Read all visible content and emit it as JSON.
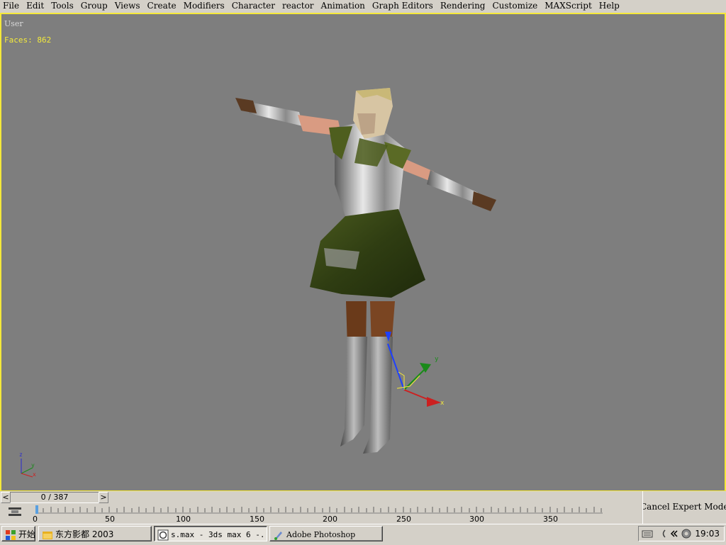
{
  "menubar": {
    "items": [
      {
        "label": "File"
      },
      {
        "label": "Edit"
      },
      {
        "label": "Tools"
      },
      {
        "label": "Group"
      },
      {
        "label": "Views"
      },
      {
        "label": "Create"
      },
      {
        "label": "Modifiers"
      },
      {
        "label": "Character"
      },
      {
        "label": "reactor"
      },
      {
        "label": "Animation"
      },
      {
        "label": "Graph Editors"
      },
      {
        "label": "Rendering"
      },
      {
        "label": "Customize"
      },
      {
        "label": "MAXScript"
      },
      {
        "label": "Help"
      }
    ]
  },
  "viewport": {
    "label": "User",
    "faces": "Faces: 862",
    "gizmo_axes": {
      "x": "x",
      "y": "y",
      "z": "z"
    },
    "corner_axes": {
      "x": "x",
      "y": "y",
      "z": "z"
    },
    "border_color": "#f5e83a",
    "background_color": "#7e7e7e"
  },
  "time_slider": {
    "value": "0 / 387",
    "prev_button": "<",
    "next_button": ">",
    "current_frame": 0,
    "total_frames": 387
  },
  "trackbar": {
    "tick_labels": [
      "0",
      "50",
      "100",
      "150",
      "200",
      "250",
      "300",
      "350"
    ]
  },
  "status": {
    "text": "Cancel Expert Mode"
  },
  "taskbar": {
    "start_label": "开始",
    "tasks": [
      {
        "label": "东方影都 2003",
        "icon": "folder-icon"
      },
      {
        "label": "s.max - 3ds max 6 -...",
        "icon": "max-icon"
      },
      {
        "label": "Adobe Photoshop",
        "icon": "photoshop-icon"
      }
    ],
    "tray_icons": [
      "keyboard-icon",
      "ime-icon",
      "volume-icon"
    ],
    "clock": "19:03"
  }
}
